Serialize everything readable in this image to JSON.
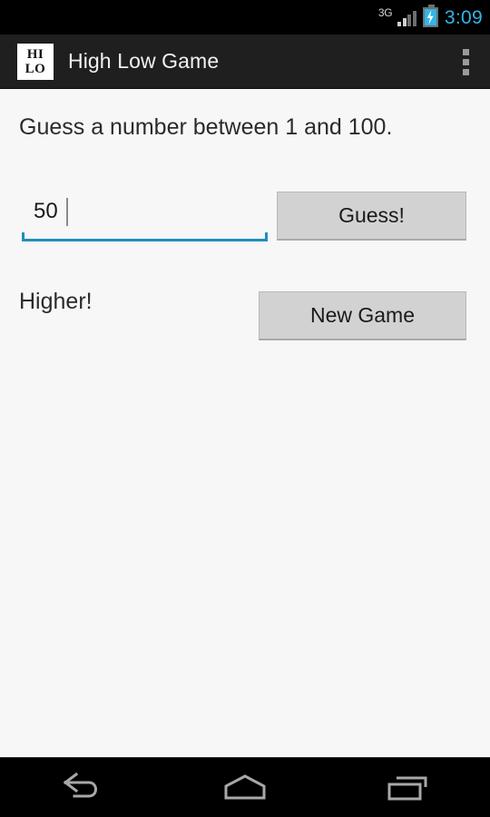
{
  "status_bar": {
    "network_label": "3G",
    "signal_icon": "signal-bars-icon",
    "battery_icon": "battery-charging-icon",
    "time": "3:09",
    "time_color": "#33b5e5",
    "background": "#000000"
  },
  "action_bar": {
    "app_icon_line1": "HI",
    "app_icon_line2": "LO",
    "title": "High Low Game",
    "overflow_icon": "overflow-menu-icon",
    "background": "#1f1f1f"
  },
  "content": {
    "prompt": "Guess a number between 1 and 100.",
    "guess_input": {
      "value": "50",
      "placeholder": "",
      "underline_color": "#1f8fbb"
    },
    "guess_button_label": "Guess!",
    "result_message": "Higher!",
    "new_game_button_label": "New Game",
    "background": "#f7f7f7",
    "button_color": "#d2d2d2"
  },
  "nav_bar": {
    "back_icon": "back-arrow-icon",
    "home_icon": "home-icon",
    "recents_icon": "recent-apps-icon",
    "background": "#000000"
  }
}
